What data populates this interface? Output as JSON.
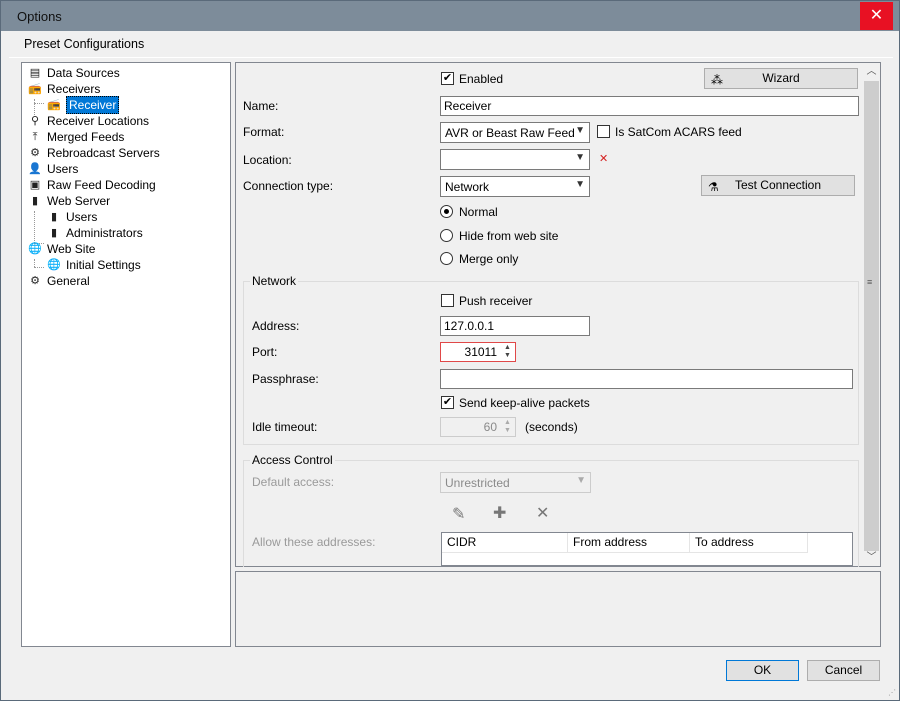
{
  "window": {
    "title": "Options",
    "close_label": "✕"
  },
  "menu": {
    "preset_label": "Preset Configurations"
  },
  "tree": {
    "items": [
      {
        "label": "Data Sources",
        "icon": "document-icon"
      },
      {
        "label": "Receivers",
        "icon": "radio-icon"
      },
      {
        "label": "Receiver",
        "icon": "radio-icon"
      },
      {
        "label": "Receiver Locations",
        "icon": "location-pin-icon"
      },
      {
        "label": "Merged Feeds",
        "icon": "merge-arrows-icon"
      },
      {
        "label": "Rebroadcast Servers",
        "icon": "gears-icon"
      },
      {
        "label": "Users",
        "icon": "user-icon"
      },
      {
        "label": "Raw Feed Decoding",
        "icon": "decoding-icon"
      },
      {
        "label": "Web Server",
        "icon": "server-icon"
      },
      {
        "label": "Users",
        "icon": "server-icon"
      },
      {
        "label": "Administrators",
        "icon": "server-icon"
      },
      {
        "label": "Web Site",
        "icon": "globe-icon"
      },
      {
        "label": "Initial Settings",
        "icon": "globe-icon"
      },
      {
        "label": "General",
        "icon": "gear-icon"
      }
    ]
  },
  "form": {
    "enabled_label": "Enabled",
    "enabled_checked": "✔",
    "wizard_label": "Wizard",
    "name_label": "Name:",
    "name_value": "Receiver",
    "format_label": "Format:",
    "format_value": "AVR or Beast Raw Feed",
    "satcom_label": "Is SatCom ACARS feed",
    "location_label": "Location:",
    "location_value": "",
    "location_clear": "✕",
    "conn_type_label": "Connection type:",
    "conn_type_value": "Network",
    "test_conn_label": "Test Connection",
    "radio_normal": "Normal",
    "radio_hide": "Hide from web site",
    "radio_merge": "Merge only"
  },
  "network": {
    "group_title": "Network",
    "push_label": "Push receiver",
    "address_label": "Address:",
    "address_value": "127.0.0.1",
    "port_label": "Port:",
    "port_value": "31011",
    "passphrase_label": "Passphrase:",
    "passphrase_value": "",
    "keepalive_label": "Send keep-alive packets",
    "keepalive_checked": "✔",
    "idle_label": "Idle timeout:",
    "idle_value": "60",
    "idle_unit": "(seconds)"
  },
  "access": {
    "group_title": "Access Control",
    "default_label": "Default access:",
    "default_value": "Unrestricted",
    "allow_label": "Allow these addresses:",
    "columns": [
      "CIDR",
      "From address",
      "To address"
    ]
  },
  "dialog": {
    "ok_label": "OK",
    "cancel_label": "Cancel"
  },
  "colors": {
    "accent": "#0078d7",
    "close_red": "#e81123",
    "titlebar": "#7d8c9a"
  }
}
